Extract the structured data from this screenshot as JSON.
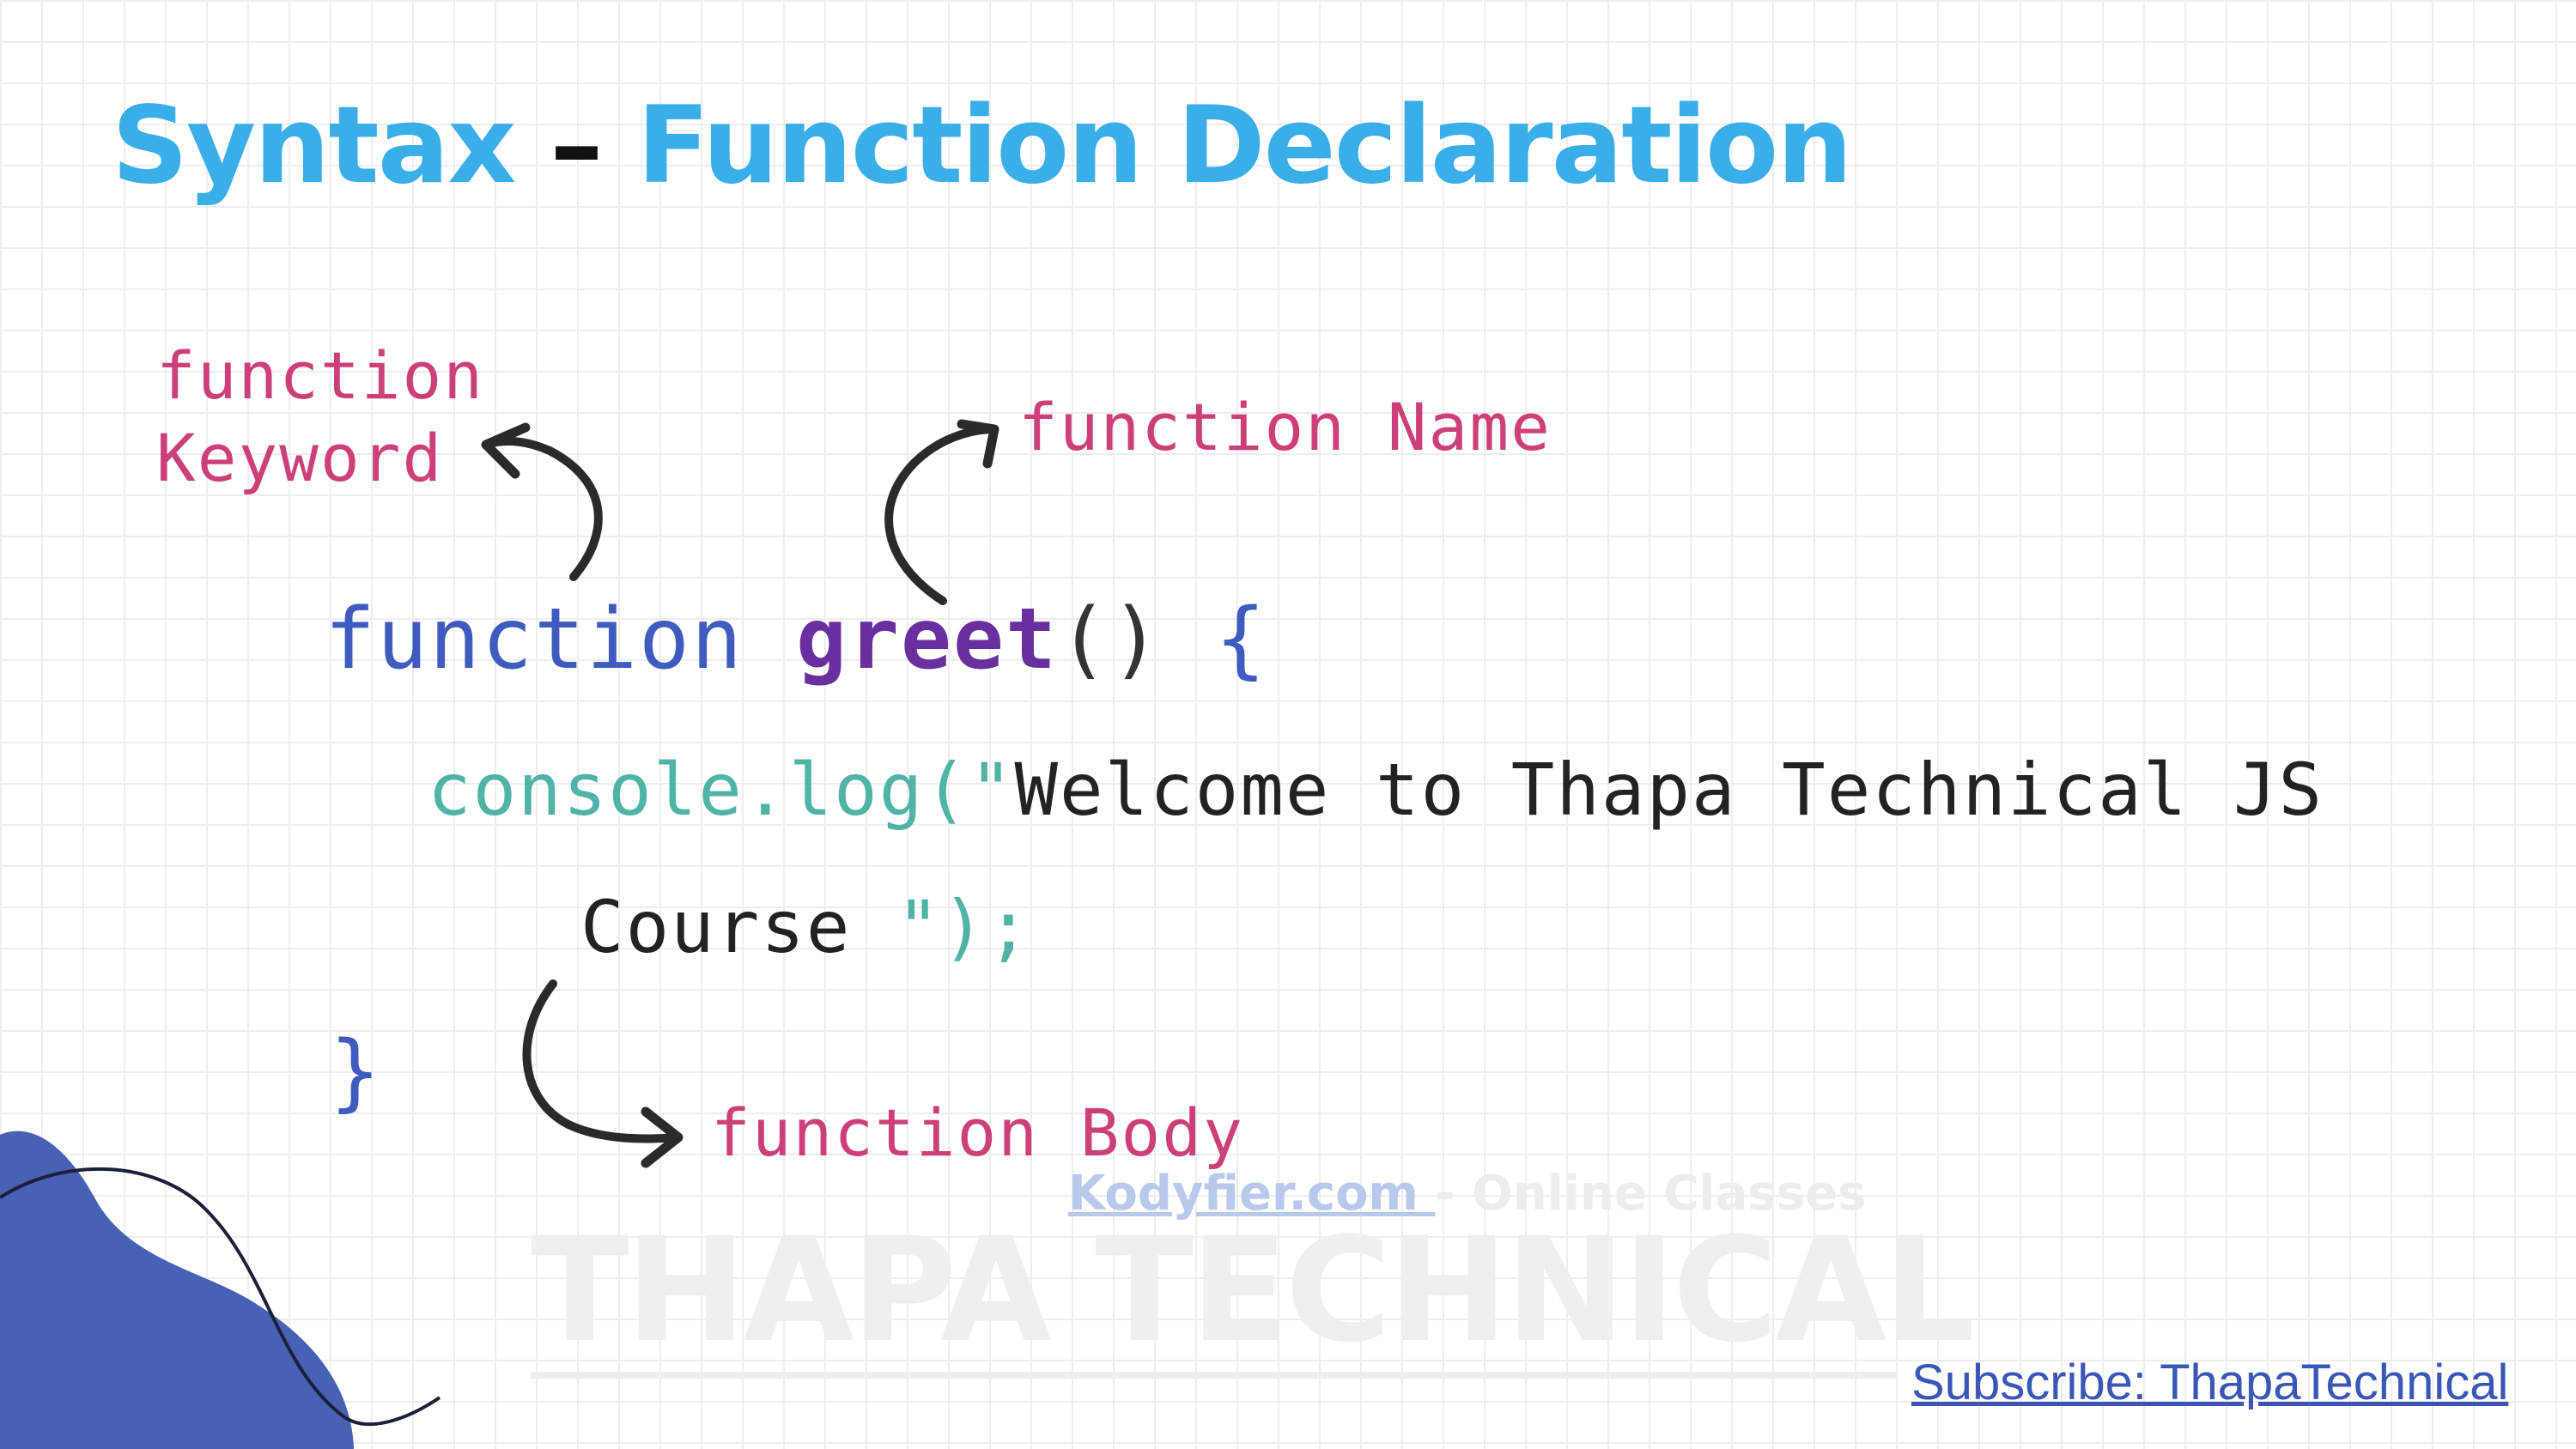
{
  "slide": {
    "title": {
      "part1": "Syntax",
      "dash": " – ",
      "part2": "Function Declaration"
    },
    "labels": {
      "keyword_line1": "function",
      "keyword_line2": "Keyword",
      "name": "function Name",
      "body": "function Body"
    },
    "code": {
      "keyword": "function",
      "name": "greet",
      "signature_rest": "() ",
      "open_brace": "{",
      "call": "console.log(\"",
      "string_line1": "Welcome to Thapa Technical JS",
      "string_line2": "Course ",
      "call_end": "\");",
      "close_brace": "}"
    },
    "watermark": {
      "site": "Kodyfier.com ",
      "site_suffix": "- Online Classes",
      "brand": "THAPA TECHNICAL"
    },
    "subscribe": "Subscribe: ThapaTechnical",
    "colors": {
      "title": "#3aaee8",
      "label": "#cc3f79",
      "keyword": "#3f5bc0",
      "function_name": "#6a2f9e",
      "call": "#4fb3a5",
      "blob": "#4761b5",
      "link": "#3a57b8"
    }
  }
}
